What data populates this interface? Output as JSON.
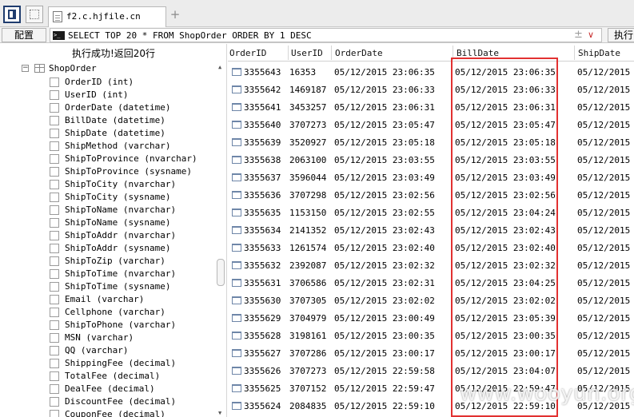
{
  "tab": {
    "title": "f2.c.hjfile.cn",
    "new_tab": "+"
  },
  "toolbar": {
    "config_label": "配置",
    "sql": "SELECT TOP 20 * FROM ShopOrder ORDER BY 1 DESC",
    "pm_symbol": "±",
    "dropdown_symbol": "∨",
    "execute_label": "执行"
  },
  "status": "执行成功!返回20行",
  "tree": {
    "table": "ShopOrder",
    "toggle": "−",
    "columns": [
      "OrderID (int)",
      "UserID (int)",
      "OrderDate (datetime)",
      "BillDate (datetime)",
      "ShipDate (datetime)",
      "ShipMethod (varchar)",
      "ShipToProvince (nvarchar)",
      "ShipToProvince (sysname)",
      "ShipToCity (nvarchar)",
      "ShipToCity (sysname)",
      "ShipToName (nvarchar)",
      "ShipToName (sysname)",
      "ShipToAddr (nvarchar)",
      "ShipToAddr (sysname)",
      "ShipToZip (varchar)",
      "ShipToTime (nvarchar)",
      "ShipToTime (sysname)",
      "Email (varchar)",
      "Cellphone (varchar)",
      "ShipToPhone (varchar)",
      "MSN (varchar)",
      "QQ (varchar)",
      "ShippingFee (decimal)",
      "TotalFee (decimal)",
      "DealFee (decimal)",
      "DiscountFee (decimal)",
      "CouponFee (decimal)"
    ]
  },
  "grid": {
    "headers": [
      "OrderID",
      "UserID",
      "OrderDate",
      "BillDate",
      "ShipDate"
    ],
    "rows": [
      [
        "3355643",
        "16353",
        "05/12/2015 23:06:35",
        "05/12/2015 23:06:35",
        "05/12/2015"
      ],
      [
        "3355642",
        "1469187",
        "05/12/2015 23:06:33",
        "05/12/2015 23:06:33",
        "05/12/2015"
      ],
      [
        "3355641",
        "3453257",
        "05/12/2015 23:06:31",
        "05/12/2015 23:06:31",
        "05/12/2015"
      ],
      [
        "3355640",
        "3707273",
        "05/12/2015 23:05:47",
        "05/12/2015 23:05:47",
        "05/12/2015"
      ],
      [
        "3355639",
        "3520927",
        "05/12/2015 23:05:18",
        "05/12/2015 23:05:18",
        "05/12/2015"
      ],
      [
        "3355638",
        "2063100",
        "05/12/2015 23:03:55",
        "05/12/2015 23:03:55",
        "05/12/2015"
      ],
      [
        "3355637",
        "3596044",
        "05/12/2015 23:03:49",
        "05/12/2015 23:03:49",
        "05/12/2015"
      ],
      [
        "3355636",
        "3707298",
        "05/12/2015 23:02:56",
        "05/12/2015 23:02:56",
        "05/12/2015"
      ],
      [
        "3355635",
        "1153150",
        "05/12/2015 23:02:55",
        "05/12/2015 23:04:24",
        "05/12/2015"
      ],
      [
        "3355634",
        "2141352",
        "05/12/2015 23:02:43",
        "05/12/2015 23:02:43",
        "05/12/2015"
      ],
      [
        "3355633",
        "1261574",
        "05/12/2015 23:02:40",
        "05/12/2015 23:02:40",
        "05/12/2015"
      ],
      [
        "3355632",
        "2392087",
        "05/12/2015 23:02:32",
        "05/12/2015 23:02:32",
        "05/12/2015"
      ],
      [
        "3355631",
        "3706586",
        "05/12/2015 23:02:31",
        "05/12/2015 23:04:25",
        "05/12/2015"
      ],
      [
        "3355630",
        "3707305",
        "05/12/2015 23:02:02",
        "05/12/2015 23:02:02",
        "05/12/2015"
      ],
      [
        "3355629",
        "3704979",
        "05/12/2015 23:00:49",
        "05/12/2015 23:05:39",
        "05/12/2015"
      ],
      [
        "3355628",
        "3198161",
        "05/12/2015 23:00:35",
        "05/12/2015 23:00:35",
        "05/12/2015"
      ],
      [
        "3355627",
        "3707286",
        "05/12/2015 23:00:17",
        "05/12/2015 23:00:17",
        "05/12/2015"
      ],
      [
        "3355626",
        "3707273",
        "05/12/2015 22:59:58",
        "05/12/2015 23:04:07",
        "05/12/2015"
      ],
      [
        "3355625",
        "3707152",
        "05/12/2015 22:59:47",
        "05/12/2015 22:59:47",
        "05/12/2015"
      ],
      [
        "3355624",
        "2084835",
        "05/12/2015 22:59:10",
        "05/12/2015 22:59:10",
        "05/12/2015"
      ]
    ]
  },
  "watermark": "www.wooyun.org",
  "colors": {
    "highlight": "#e23131",
    "terminal_icon": "#1b1b1b"
  },
  "icons": {
    "sidebar_toggle": "sidebar-toggle-icon",
    "grid_view": "grid-view-icon",
    "tab_document": "document-icon",
    "terminal": "terminal-icon",
    "table": "table-icon",
    "row": "row-icon"
  }
}
